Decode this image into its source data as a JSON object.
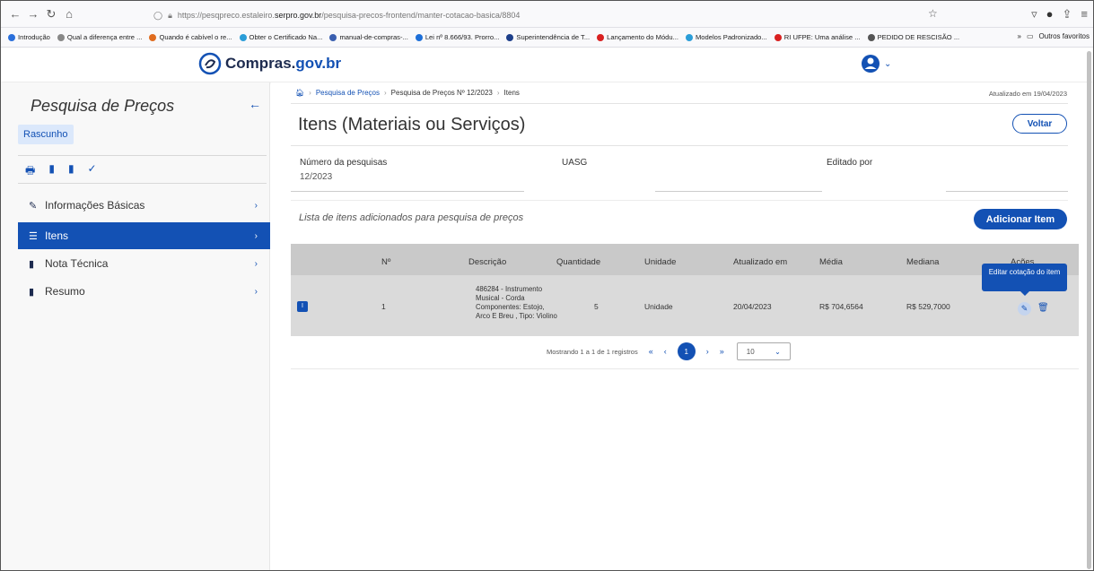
{
  "browser": {
    "url_prefix": "https://pesqpreco.estaleiro.",
    "url_domain": "serpro.gov.br",
    "url_path": "/pesquisa-precos-frontend/manter-cotacao-basica/8804",
    "bookmarks": [
      {
        "label": "Introdução",
        "color": "#2a6fdb"
      },
      {
        "label": "Qual a diferença entre ...",
        "color": "#888888"
      },
      {
        "label": "Quando é cabível o re...",
        "color": "#e06c1f"
      },
      {
        "label": "Obter o Certificado Na...",
        "color": "#2a9dd8"
      },
      {
        "label": "manual-de-compras-...",
        "color": "#3a5fb0"
      },
      {
        "label": "Lei nº 8.666/93. Prorro...",
        "color": "#1d6fd8"
      },
      {
        "label": "Superintendência de T...",
        "color": "#1d3f8a"
      },
      {
        "label": "Lançamento do Módu...",
        "color": "#d92020"
      },
      {
        "label": "Modelos Padronizado...",
        "color": "#2a9dd8"
      },
      {
        "label": "RI UFPE: Uma análise ...",
        "color": "#d92020"
      },
      {
        "label": "PEDIDO DE RESCISÃO ...",
        "color": "#555555"
      }
    ],
    "bookmarks_more": "»",
    "other_favorites": "Outros favoritos"
  },
  "header": {
    "logo_text": "Compras.",
    "logo_gov": "gov.br"
  },
  "sidebar": {
    "title": "Pesquisa de Preços",
    "status_badge": "Rascunho",
    "menu": [
      {
        "label": "Informações Básicas",
        "icon": "pencil-icon",
        "glyph": "✎"
      },
      {
        "label": "Itens",
        "icon": "list-icon",
        "glyph": "☰"
      },
      {
        "label": "Nota Técnica",
        "icon": "file-icon",
        "glyph": "▮"
      },
      {
        "label": "Resumo",
        "icon": "file-text-icon",
        "glyph": "▮"
      }
    ]
  },
  "breadcrumb": {
    "link1": "Pesquisa de Preços",
    "item2": "Pesquisa de Preços Nº 12/2023",
    "item3": "Itens"
  },
  "updated_text": "Atualizado em 19/04/2023",
  "page_title": "Itens (Materiais ou Serviços)",
  "back_button": "Voltar",
  "fields": {
    "numero_label": "Número da pesquisas",
    "numero_value": "12/2023",
    "uasg_label": "UASG",
    "editado_label": "Editado por"
  },
  "list_caption": "Lista de itens adicionados para pesquisa de preços",
  "add_button": "Adicionar Item",
  "table": {
    "headers": {
      "numero": "Nº",
      "descricao": "Descrição",
      "quantidade": "Quantidade",
      "unidade": "Unidade",
      "atualizado": "Atualizado em",
      "media": "Média",
      "mediana": "Mediana",
      "acoes": "Ações"
    },
    "rows": [
      {
        "check": "I",
        "numero": "1",
        "descricao": "486284 - Instrumento Musical - Corda Componentes: Estojo, Arco E Breu , Tipo: Violino",
        "quantidade": "5",
        "unidade": "Unidade",
        "atualizado": "20/04/2023",
        "media": "R$ 704,6564",
        "mediana": "R$ 529,7000"
      }
    ]
  },
  "tooltip": "Editar cotação do item",
  "pagination": {
    "summary": "Mostrando 1 a 1 de 1 registros",
    "current_page": "1",
    "page_size": "10"
  },
  "colors": {
    "primary": "#1351b4",
    "sidebar_bg": "#f8f8f8",
    "table_head": "#c9c9c9",
    "table_row": "#dadada"
  }
}
